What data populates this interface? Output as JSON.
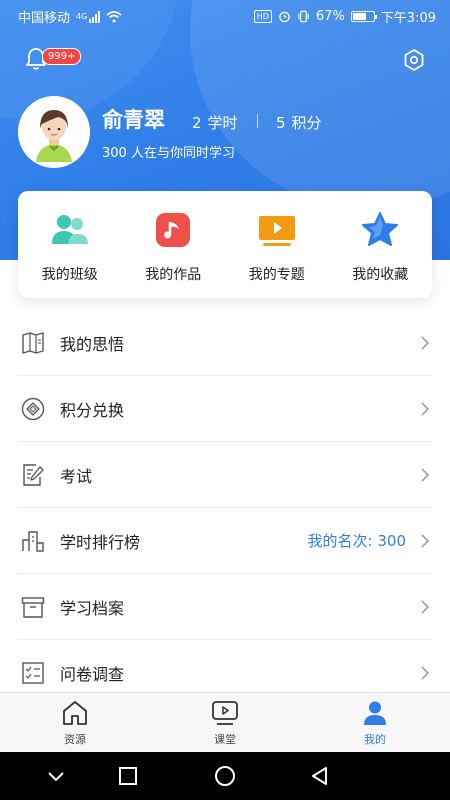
{
  "status_bar": {
    "carrier": "中国移动",
    "network": "4G",
    "hd": "HD",
    "battery": "67%",
    "battery_level": 0.67,
    "time": "下午3:09"
  },
  "header": {
    "notification_badge": "999+",
    "user_name": "俞青翠",
    "study_hours": {
      "value": "2",
      "label": "学时"
    },
    "points": {
      "value": "5",
      "label": "积分"
    },
    "online_text": "300 人在与你同时学习"
  },
  "quick_actions": [
    {
      "label": "我的班级",
      "icon": "users-icon"
    },
    {
      "label": "我的作品",
      "icon": "music-note-icon"
    },
    {
      "label": "我的专题",
      "icon": "play-screen-icon"
    },
    {
      "label": "我的收藏",
      "icon": "star-icon"
    }
  ],
  "menu": [
    {
      "label": "我的思悟",
      "icon": "book-icon",
      "extra": ""
    },
    {
      "label": "积分兑换",
      "icon": "exchange-icon",
      "extra": ""
    },
    {
      "label": "考试",
      "icon": "exam-edit-icon",
      "extra": ""
    },
    {
      "label": "学时排行榜",
      "icon": "ranking-icon",
      "extra": "我的名次: 300"
    },
    {
      "label": "学习档案",
      "icon": "archive-box-icon",
      "extra": ""
    },
    {
      "label": "问卷调查",
      "icon": "checklist-icon",
      "extra": ""
    }
  ],
  "tabbar": [
    {
      "label": "资源",
      "icon": "home-icon",
      "active": false
    },
    {
      "label": "课堂",
      "icon": "video-play-icon",
      "active": false
    },
    {
      "label": "我的",
      "icon": "person-icon",
      "active": true
    }
  ],
  "colors": {
    "primary": "#2f7de8",
    "header_bg": "#3e8ef0",
    "badge_red": "#f24545",
    "teal": "#3ec7b3",
    "orange": "#f39c12",
    "red": "#f0504a"
  }
}
